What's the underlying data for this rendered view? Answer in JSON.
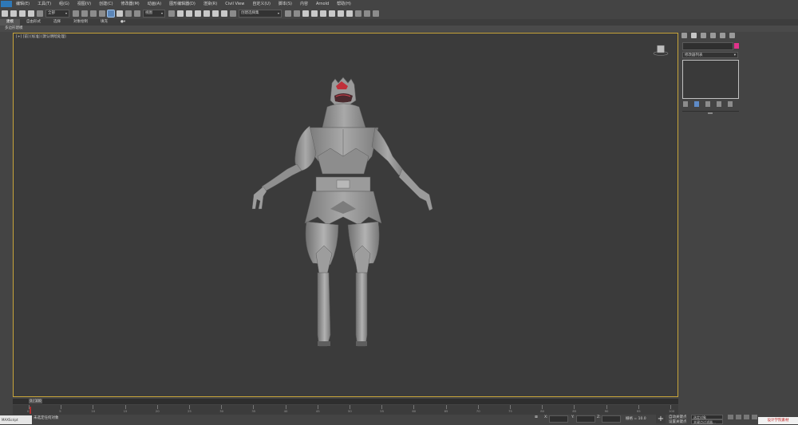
{
  "menu": {
    "items": [
      "编辑(E)",
      "工具(T)",
      "组(G)",
      "视图(V)",
      "创建(C)",
      "修改器(M)",
      "动画(A)",
      "图形编辑器(D)",
      "渲染(R)",
      "Civil View",
      "自定义(U)",
      "脚本(S)",
      "内容",
      "Arnold",
      "帮助(H)"
    ]
  },
  "toolbar": {
    "selection_filter": "全部",
    "ref_coord": "视图",
    "named_selection": "创建选择集"
  },
  "ribbon": {
    "tabs": [
      "建模",
      "自由形式",
      "选择",
      "对象绘制",
      "填充"
    ],
    "subtitle": "多边形建模"
  },
  "viewport": {
    "label": "[+] [前] [标准] [默认明暗处理]"
  },
  "command_panel": {
    "modifier_list": "修改器列表"
  },
  "timeline": {
    "slider": "0 / 100",
    "ticks": [
      "0",
      "5",
      "10",
      "15",
      "20",
      "25",
      "30",
      "35",
      "40",
      "45",
      "50",
      "55",
      "60",
      "65",
      "70",
      "75",
      "80",
      "85",
      "90",
      "95",
      "100"
    ]
  },
  "status": {
    "logo": "MAXScript",
    "message": "未选定任何对象",
    "x_label": "X:",
    "y_label": "Y:",
    "z_label": "Z:",
    "grid": "栅格 = 10.0",
    "auto_key": "自动关键点",
    "set_key": "设置关键点",
    "selected_object": "选定对象",
    "key_filters": "关键点过滤器...",
    "watermark": "设计学院素材"
  },
  "colors": {
    "viewport_bg": "#3b3b3b",
    "active_border": "#c9a53a",
    "object_color": "#e0338a",
    "helmet_red": "#c0303a"
  }
}
